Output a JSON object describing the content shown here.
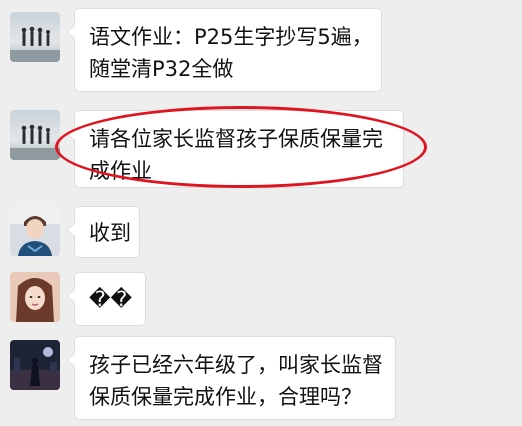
{
  "messages": [
    {
      "avatar_icon": "avatar-silhouettes-beach",
      "lines": [
        "语文作业：P25生字抄写5遍，",
        "随堂清P32全做"
      ]
    },
    {
      "avatar_icon": "avatar-silhouettes-beach",
      "lines": [
        "请各位家长监督孩子保质保量完",
        "成作业"
      ],
      "highlighted": true
    },
    {
      "avatar_icon": "avatar-boy-photo",
      "lines": [
        "收到"
      ]
    },
    {
      "avatar_icon": "avatar-girl-photo",
      "lines": [
        "��"
      ]
    },
    {
      "avatar_icon": "avatar-night-scene",
      "lines": [
        "孩子已经六年级了，叫家长监督",
        "保质保量完成作业，合理吗？"
      ]
    }
  ],
  "colors": {
    "background": "#eeeeee",
    "bubble": "#ffffff",
    "highlight_ellipse": "#e0141e"
  }
}
